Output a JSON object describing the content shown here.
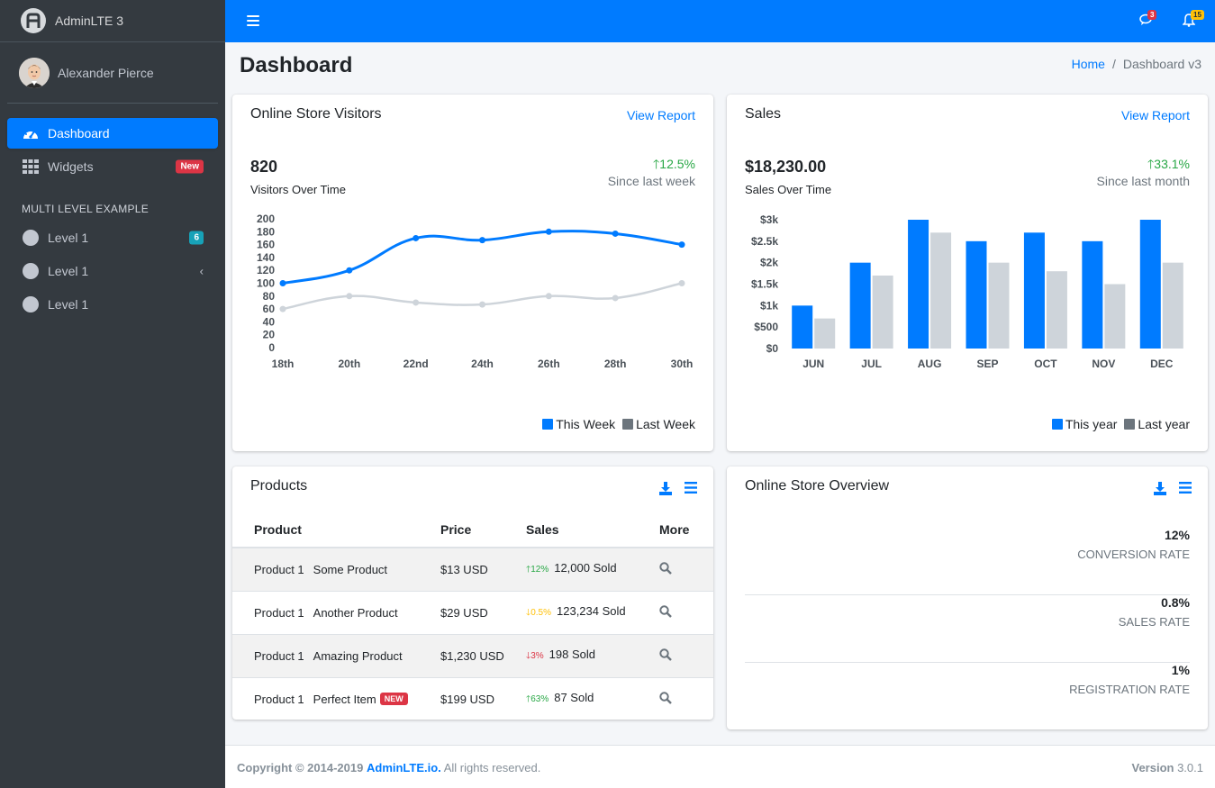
{
  "brand": {
    "name": "AdminLTE 3"
  },
  "user": {
    "name": "Alexander Pierce"
  },
  "sidebar": {
    "items": [
      {
        "label": "Dashboard",
        "icon": "tachometer-icon",
        "active": true
      },
      {
        "label": "Widgets",
        "icon": "grid-icon",
        "badge": "New"
      }
    ],
    "header": "MULTI LEVEL EXAMPLE",
    "levels": [
      {
        "label": "Level 1",
        "badge": "6"
      },
      {
        "label": "Level 1",
        "chevron": "‹"
      },
      {
        "label": "Level 1"
      }
    ]
  },
  "topbar": {
    "messages_count": "3",
    "notifications_count": "15"
  },
  "page": {
    "title": "Dashboard"
  },
  "breadcrumb": {
    "home": "Home",
    "current": "Dashboard v3"
  },
  "visitors_card": {
    "title": "Online Store Visitors",
    "link": "View Report",
    "value": "820",
    "sub_label": "Visitors Over Time",
    "trend": "12.5%",
    "trend_label": "Since last week",
    "legend_this": "This Week",
    "legend_last": "Last Week"
  },
  "sales_card": {
    "title": "Sales",
    "link": "View Report",
    "value": "$18,230.00",
    "sub_label": "Sales Over Time",
    "trend": "33.1%",
    "trend_label": "Since last month",
    "legend_this": "This year",
    "legend_last": "Last year"
  },
  "products_card": {
    "title": "Products",
    "headers": {
      "product": "Product",
      "price": "Price",
      "sales": "Sales",
      "more": "More"
    },
    "rows": [
      {
        "img": "Product 1",
        "name": "Some Product",
        "price": "$13 USD",
        "pct": "12%",
        "dir": "up",
        "sold": "12,000 Sold"
      },
      {
        "img": "Product 1",
        "name": "Another Product",
        "price": "$29 USD",
        "pct": "0.5%",
        "dir": "flat",
        "sold": "123,234 Sold"
      },
      {
        "img": "Product 1",
        "name": "Amazing Product",
        "price": "$1,230 USD",
        "pct": "3%",
        "dir": "down",
        "sold": "198 Sold"
      },
      {
        "img": "Product 1",
        "name": "Perfect Item",
        "badge": "NEW",
        "price": "$199 USD",
        "pct": "63%",
        "dir": "up",
        "sold": "87 Sold"
      }
    ]
  },
  "overview_card": {
    "title": "Online Store Overview",
    "rows": [
      {
        "value": "12%",
        "label": "CONVERSION RATE"
      },
      {
        "value": "0.8%",
        "label": "SALES RATE"
      },
      {
        "value": "1%",
        "label": "REGISTRATION RATE"
      }
    ]
  },
  "footer": {
    "copyright": "Copyright © 2014-2019",
    "link": "AdminLTE.io.",
    "rights": "All rights reserved.",
    "version_label": "Version",
    "version": "3.0.1"
  },
  "colors": {
    "primary": "#007bff",
    "gray": "#ced4da",
    "success": "#28a745",
    "warning": "#ffc107",
    "danger": "#dc3545"
  },
  "chart_data": [
    {
      "type": "line",
      "x": [
        "18th",
        "20th",
        "22nd",
        "24th",
        "26th",
        "28th",
        "30th"
      ],
      "series": [
        {
          "name": "This Week",
          "values": [
            100,
            120,
            170,
            167,
            180,
            177,
            160
          ]
        },
        {
          "name": "Last Week",
          "values": [
            60,
            80,
            70,
            67,
            80,
            77,
            100
          ]
        }
      ],
      "yticks": [
        "200",
        "180",
        "160",
        "140",
        "120",
        "100",
        "80",
        "60",
        "40",
        "20",
        "0"
      ],
      "ylim": [
        0,
        200
      ]
    },
    {
      "type": "bar",
      "categories": [
        "JUN",
        "JUL",
        "AUG",
        "SEP",
        "OCT",
        "NOV",
        "DEC"
      ],
      "series": [
        {
          "name": "This year",
          "values": [
            1000,
            2000,
            3000,
            2500,
            2700,
            2500,
            3000
          ]
        },
        {
          "name": "Last year",
          "values": [
            700,
            1700,
            2700,
            2000,
            1800,
            1500,
            2000
          ]
        }
      ],
      "yticks": [
        "$3k",
        "$2.5k",
        "$2k",
        "$1.5k",
        "$1k",
        "$500",
        "$0"
      ],
      "ylim": [
        0,
        3000
      ]
    }
  ]
}
